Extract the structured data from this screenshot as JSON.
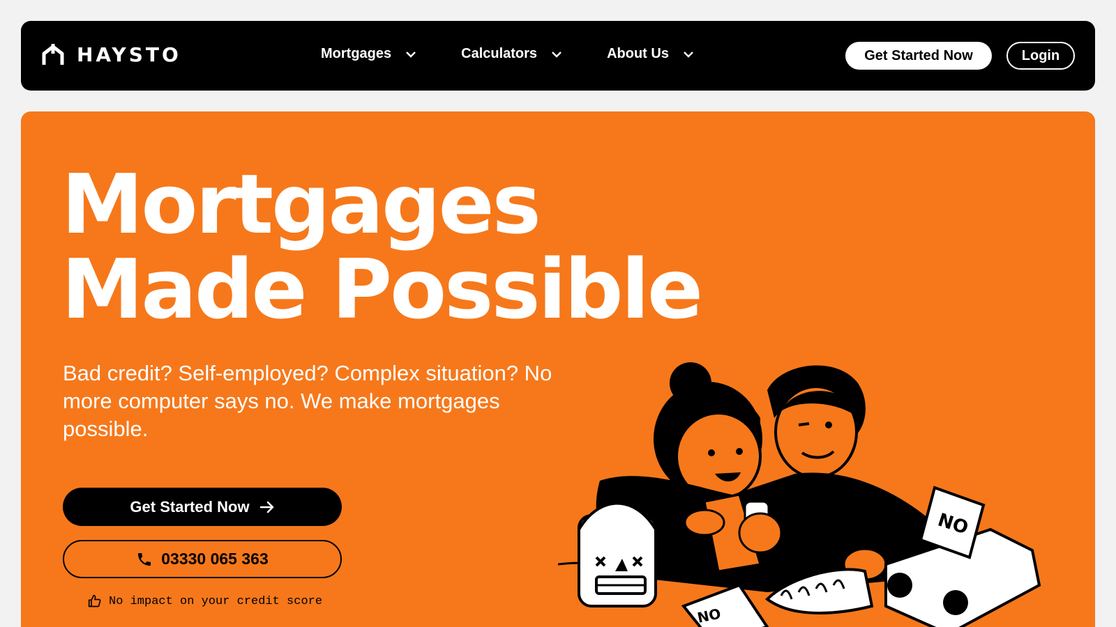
{
  "nav": {
    "logo_text": "HAYSTO",
    "logo_icon": "house-icon",
    "items": [
      {
        "label": "Mortgages",
        "icon": "chevron-down-icon"
      },
      {
        "label": "Calculators",
        "icon": "chevron-down-icon"
      },
      {
        "label": "About Us",
        "icon": "chevron-down-icon"
      }
    ],
    "cta_label": "Get Started Now",
    "login_label": "Login"
  },
  "hero": {
    "headline_line1": "Mortgages",
    "headline_line2": "Made Possible",
    "subtitle": "Bad credit? Self-employed? Complex situation? No more computer says no. We make mortgages possible.",
    "cta_label": "Get Started Now",
    "cta_icon": "arrow-right-icon",
    "phone_label": "03330 065 363",
    "phone_icon": "phone-icon",
    "credit_note": "No impact on your credit score",
    "credit_icon": "thumbs-up-icon",
    "illustration_label_no": "NO"
  },
  "colors": {
    "brand_orange": "#f6781b",
    "nav_background": "#000000",
    "page_background": "#f2f2f2"
  }
}
